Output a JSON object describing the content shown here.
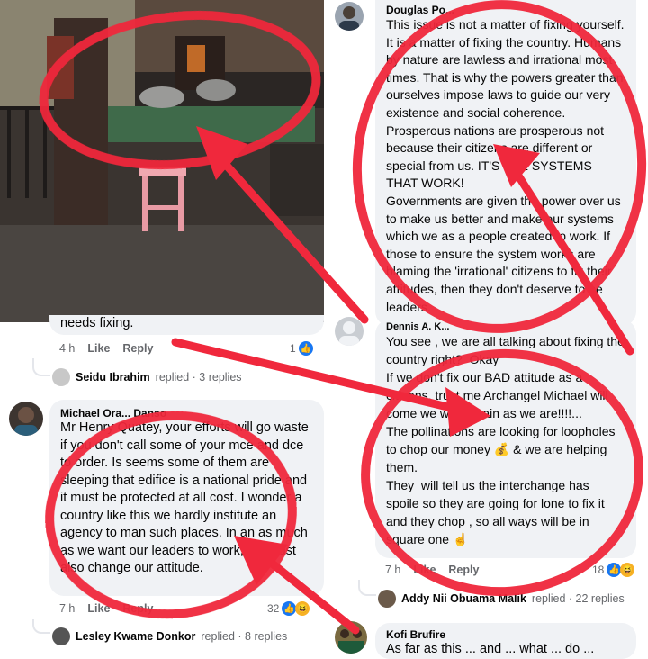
{
  "colors": {
    "annotation_red": "#f0283c",
    "fb_blue": "#1877f2",
    "bubble_gray": "#f0f2f5",
    "meta_gray": "#65676b"
  },
  "photo": {
    "description_icon": "street-vendor-photo"
  },
  "left_top": {
    "partial_text": "needs fixing.",
    "time": "4 h",
    "like": "Like",
    "reply": "Reply",
    "reaction_count": "1",
    "replies_author": "Seidu Ibrahim",
    "replies_text": "replied · 3 replies"
  },
  "michael": {
    "author": "Michael Ora... Danso",
    "text": "Mr Henry Quatey, your efforts will go waste if you don't call some of your mce and dce to order. Is seems some of them are sleeping that edifice is a national pride and it must be protected at all cost. I wonder a country like this we hardly institute an agency to man such places. In an as much as we want our leaders to work, we must also change our attitude.",
    "time": "7 h",
    "like": "Like",
    "reply": "Reply",
    "reaction_count": "32",
    "replies_author": "Lesley Kwame Donkor",
    "replies_text": "replied · 8 replies"
  },
  "douglas": {
    "author": "Douglas Po...",
    "text": "This issue is not a matter of fixing yourself. It is a matter of fixing the country. Humans by nature are lawless and irrational most times. That is why the powers greater than ourselves impose laws to guide our very existence and social coherence.\nProsperous nations are prosperous not because their citizens are different or special from us. IT'S THE SYSTEMS THAT WORK!\nGovernments are given the power over us to make us better and make our systems which we as a people created to work. If those to ensure the system works are blaming the 'irrational' citizens to fix their attitudes, then they don't deserve to be leaders."
  },
  "dennis": {
    "author": "Dennis A. K...",
    "text": "You see , we are all talking about fixing the country right?  Okay\nIf we don't fix our BAD attitude as a citizens, trust me Archangel Michael will come we will remain as we are!!!!...\nThe pollinations are looking for loopholes to chop our money 💰 & we are helping them.\nThey  will tell us the interchange has spoile so they are going for lone to fix it and they chop , so all ways will be in square one ☝",
    "time": "7 h",
    "like": "Like",
    "reply": "Reply",
    "reaction_count": "18",
    "replies_author": "Addy Nii Obuama Malik",
    "replies_text": "replied · 22 replies"
  },
  "kofi": {
    "author": "Kofi Brufire",
    "partial_text": "As far as this ... and ... what ... do ..."
  }
}
